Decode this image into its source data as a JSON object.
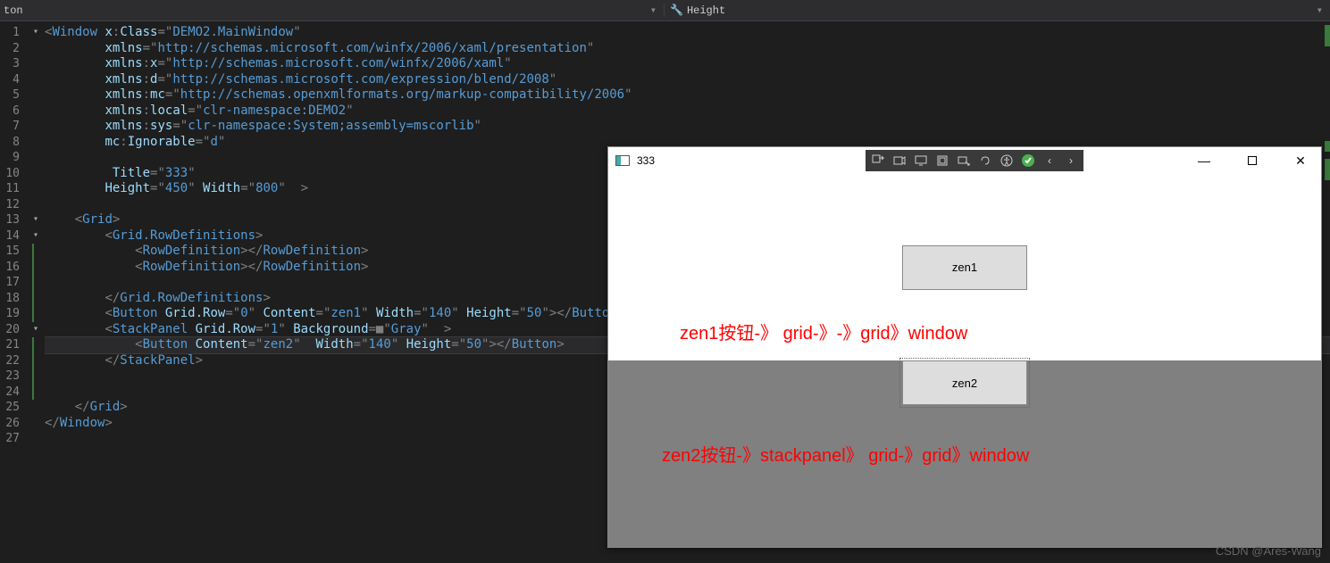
{
  "topbar": {
    "left_label": "ton",
    "right_label": "Height"
  },
  "code": {
    "lines": [
      {
        "n": 1,
        "fold": "▾",
        "seg": [
          [
            "t-punc",
            "<"
          ],
          [
            "t-tag",
            "Window"
          ],
          [
            "",
            ""
          ],
          [
            "t-attr",
            " x"
          ],
          [
            "t-punc",
            ":"
          ],
          [
            "t-attr",
            "Class"
          ],
          [
            "t-punc",
            "="
          ],
          [
            "t-strq",
            "\""
          ],
          [
            "t-str",
            "DEMO2.MainWindow"
          ],
          [
            "t-strq",
            "\""
          ]
        ]
      },
      {
        "n": 2,
        "seg": [
          [
            "",
            "        "
          ],
          [
            "t-attr",
            "xmlns"
          ],
          [
            "t-punc",
            "="
          ],
          [
            "t-strq",
            "\""
          ],
          [
            "t-str",
            "http://schemas.microsoft.com/winfx/2006/xaml/presentation"
          ],
          [
            "t-strq",
            "\""
          ]
        ]
      },
      {
        "n": 3,
        "seg": [
          [
            "",
            "        "
          ],
          [
            "t-attr",
            "xmlns"
          ],
          [
            "t-punc",
            ":"
          ],
          [
            "t-attr",
            "x"
          ],
          [
            "t-punc",
            "="
          ],
          [
            "t-strq",
            "\""
          ],
          [
            "t-str",
            "http://schemas.microsoft.com/winfx/2006/xaml"
          ],
          [
            "t-strq",
            "\""
          ]
        ]
      },
      {
        "n": 4,
        "seg": [
          [
            "",
            "        "
          ],
          [
            "t-attr",
            "xmlns"
          ],
          [
            "t-punc",
            ":"
          ],
          [
            "t-attr",
            "d"
          ],
          [
            "t-punc",
            "="
          ],
          [
            "t-strq",
            "\""
          ],
          [
            "t-str",
            "http://schemas.microsoft.com/expression/blend/2008"
          ],
          [
            "t-strq",
            "\""
          ]
        ]
      },
      {
        "n": 5,
        "seg": [
          [
            "",
            "        "
          ],
          [
            "t-attr",
            "xmlns"
          ],
          [
            "t-punc",
            ":"
          ],
          [
            "t-attr",
            "mc"
          ],
          [
            "t-punc",
            "="
          ],
          [
            "t-strq",
            "\""
          ],
          [
            "t-str",
            "http://schemas.openxmlformats.org/markup-compatibility/2006"
          ],
          [
            "t-strq",
            "\""
          ]
        ]
      },
      {
        "n": 6,
        "seg": [
          [
            "",
            "        "
          ],
          [
            "t-attr",
            "xmlns"
          ],
          [
            "t-punc",
            ":"
          ],
          [
            "t-attr",
            "local"
          ],
          [
            "t-punc",
            "="
          ],
          [
            "t-strq",
            "\""
          ],
          [
            "t-str",
            "clr-namespace:DEMO2"
          ],
          [
            "t-strq",
            "\""
          ]
        ]
      },
      {
        "n": 7,
        "seg": [
          [
            "",
            "        "
          ],
          [
            "t-attr",
            "xmlns"
          ],
          [
            "t-punc",
            ":"
          ],
          [
            "t-attr",
            "sys"
          ],
          [
            "t-punc",
            "="
          ],
          [
            "t-strq",
            "\""
          ],
          [
            "t-str",
            "clr-namespace:System;assembly=mscorlib"
          ],
          [
            "t-strq",
            "\""
          ]
        ]
      },
      {
        "n": 8,
        "seg": [
          [
            "",
            "        "
          ],
          [
            "t-attr",
            "mc"
          ],
          [
            "t-punc",
            ":"
          ],
          [
            "t-attr",
            "Ignorable"
          ],
          [
            "t-punc",
            "="
          ],
          [
            "t-strq",
            "\""
          ],
          [
            "t-str",
            "d"
          ],
          [
            "t-strq",
            "\""
          ]
        ]
      },
      {
        "n": 9,
        "seg": [
          [
            "",
            ""
          ]
        ]
      },
      {
        "n": 10,
        "seg": [
          [
            "",
            "         "
          ],
          [
            "t-attr",
            "Title"
          ],
          [
            "t-punc",
            "="
          ],
          [
            "t-strq",
            "\""
          ],
          [
            "t-str",
            "333"
          ],
          [
            "t-strq",
            "\""
          ]
        ]
      },
      {
        "n": 11,
        "seg": [
          [
            "",
            "        "
          ],
          [
            "t-attr",
            "Height"
          ],
          [
            "t-punc",
            "="
          ],
          [
            "t-strq",
            "\""
          ],
          [
            "t-str",
            "450"
          ],
          [
            "t-strq",
            "\""
          ],
          [
            "",
            ""
          ],
          [
            "t-attr",
            " Width"
          ],
          [
            "t-punc",
            "="
          ],
          [
            "t-strq",
            "\""
          ],
          [
            "t-str",
            "800"
          ],
          [
            "t-strq",
            "\""
          ],
          [
            "",
            "  "
          ],
          [
            "t-punc",
            ">"
          ]
        ]
      },
      {
        "n": 12,
        "seg": [
          [
            "",
            ""
          ]
        ]
      },
      {
        "n": 13,
        "fold": "▾",
        "seg": [
          [
            "",
            "    "
          ],
          [
            "t-punc",
            "<"
          ],
          [
            "t-tag",
            "Grid"
          ],
          [
            "t-punc",
            ">"
          ]
        ]
      },
      {
        "n": 14,
        "fold": "▾",
        "seg": [
          [
            "",
            "        "
          ],
          [
            "t-punc",
            "<"
          ],
          [
            "t-tag",
            "Grid.RowDefinitions"
          ],
          [
            "t-punc",
            ">"
          ]
        ]
      },
      {
        "n": 15,
        "mark": true,
        "seg": [
          [
            "",
            "            "
          ],
          [
            "t-punc",
            "<"
          ],
          [
            "t-tag",
            "RowDefinition"
          ],
          [
            "t-punc",
            "></"
          ],
          [
            "t-tag",
            "RowDefinition"
          ],
          [
            "t-punc",
            ">"
          ]
        ]
      },
      {
        "n": 16,
        "mark": true,
        "seg": [
          [
            "",
            "            "
          ],
          [
            "t-punc",
            "<"
          ],
          [
            "t-tag",
            "RowDefinition"
          ],
          [
            "t-punc",
            "></"
          ],
          [
            "t-tag",
            "RowDefinition"
          ],
          [
            "t-punc",
            ">"
          ]
        ]
      },
      {
        "n": 17,
        "mark": true,
        "seg": [
          [
            "",
            ""
          ]
        ]
      },
      {
        "n": 18,
        "mark": true,
        "seg": [
          [
            "",
            "        "
          ],
          [
            "t-punc",
            "</"
          ],
          [
            "t-tag",
            "Grid.RowDefinitions"
          ],
          [
            "t-punc",
            ">"
          ]
        ]
      },
      {
        "n": 19,
        "mark": true,
        "seg": [
          [
            "",
            "        "
          ],
          [
            "t-punc",
            "<"
          ],
          [
            "t-tag",
            "Button"
          ],
          [
            "t-attr",
            " Grid.Row"
          ],
          [
            "t-punc",
            "="
          ],
          [
            "t-strq",
            "\""
          ],
          [
            "t-str",
            "0"
          ],
          [
            "t-strq",
            "\""
          ],
          [
            "t-attr",
            " Content"
          ],
          [
            "t-punc",
            "="
          ],
          [
            "t-strq",
            "\""
          ],
          [
            "t-str",
            "zen1"
          ],
          [
            "t-strq",
            "\""
          ],
          [
            "t-attr",
            " Width"
          ],
          [
            "t-punc",
            "="
          ],
          [
            "t-strq",
            "\""
          ],
          [
            "t-str",
            "140"
          ],
          [
            "t-strq",
            "\""
          ],
          [
            "t-attr",
            " Height"
          ],
          [
            "t-punc",
            "="
          ],
          [
            "t-strq",
            "\""
          ],
          [
            "t-str",
            "50"
          ],
          [
            "t-strq",
            "\""
          ],
          [
            "t-punc",
            "></"
          ],
          [
            "t-tag",
            "Button"
          ],
          [
            "t-punc",
            ">"
          ]
        ]
      },
      {
        "n": 20,
        "fold": "▾",
        "mark": true,
        "seg": [
          [
            "",
            "        "
          ],
          [
            "t-punc",
            "<"
          ],
          [
            "t-tag",
            "StackPanel"
          ],
          [
            "t-attr",
            " Grid.Row"
          ],
          [
            "t-punc",
            "="
          ],
          [
            "t-strq",
            "\""
          ],
          [
            "t-str",
            "1"
          ],
          [
            "t-strq",
            "\""
          ],
          [
            "t-attr",
            " Background"
          ],
          [
            "t-punc",
            "=■"
          ],
          [
            "t-strq",
            "\""
          ],
          [
            "t-str",
            "Gray"
          ],
          [
            "t-strq",
            "\""
          ],
          [
            "",
            "  "
          ],
          [
            "t-punc",
            ">"
          ]
        ]
      },
      {
        "n": 21,
        "current": true,
        "mark": true,
        "seg": [
          [
            "",
            "            "
          ],
          [
            "t-punc",
            "<"
          ],
          [
            "t-tag",
            "Button"
          ],
          [
            "t-attr",
            " Content"
          ],
          [
            "t-punc",
            "="
          ],
          [
            "t-strq",
            "\""
          ],
          [
            "t-str",
            "zen2"
          ],
          [
            "t-strq",
            "\""
          ],
          [
            "",
            "  "
          ],
          [
            "t-attr",
            "Width"
          ],
          [
            "t-punc",
            "="
          ],
          [
            "t-strq",
            "\""
          ],
          [
            "t-str",
            "140"
          ],
          [
            "t-strq",
            "\""
          ],
          [
            "t-attr",
            " Height"
          ],
          [
            "t-punc",
            "="
          ],
          [
            "t-strq",
            "\""
          ],
          [
            "t-str",
            "50"
          ],
          [
            "t-strq",
            "\""
          ],
          [
            "t-punc",
            "></"
          ],
          [
            "t-tag",
            "Button"
          ],
          [
            "t-punc",
            ">"
          ]
        ]
      },
      {
        "n": 22,
        "mark": true,
        "seg": [
          [
            "",
            "        "
          ],
          [
            "t-punc",
            "</"
          ],
          [
            "t-tag",
            "StackPanel"
          ],
          [
            "t-punc",
            ">"
          ]
        ]
      },
      {
        "n": 23,
        "mark": true,
        "seg": [
          [
            "",
            ""
          ]
        ]
      },
      {
        "n": 24,
        "mark": true,
        "seg": [
          [
            "",
            ""
          ]
        ]
      },
      {
        "n": 25,
        "seg": [
          [
            "",
            "    "
          ],
          [
            "t-punc",
            "</"
          ],
          [
            "t-tag",
            "Grid"
          ],
          [
            "t-punc",
            ">"
          ]
        ]
      },
      {
        "n": 26,
        "seg": [
          [
            "t-punc",
            "</"
          ],
          [
            "t-tag",
            "Window"
          ],
          [
            "t-punc",
            ">"
          ]
        ]
      },
      {
        "n": 27,
        "seg": [
          [
            "",
            ""
          ]
        ]
      }
    ]
  },
  "wpf": {
    "title": "333",
    "buttons": {
      "zen1": "zen1",
      "zen2": "zen2"
    },
    "annot1": "zen1按钮-》 grid-》-》grid》window",
    "annot2": "zen2按钮-》stackpanel》 grid-》grid》window"
  },
  "watermark": "CSDN @Ares-Wang"
}
